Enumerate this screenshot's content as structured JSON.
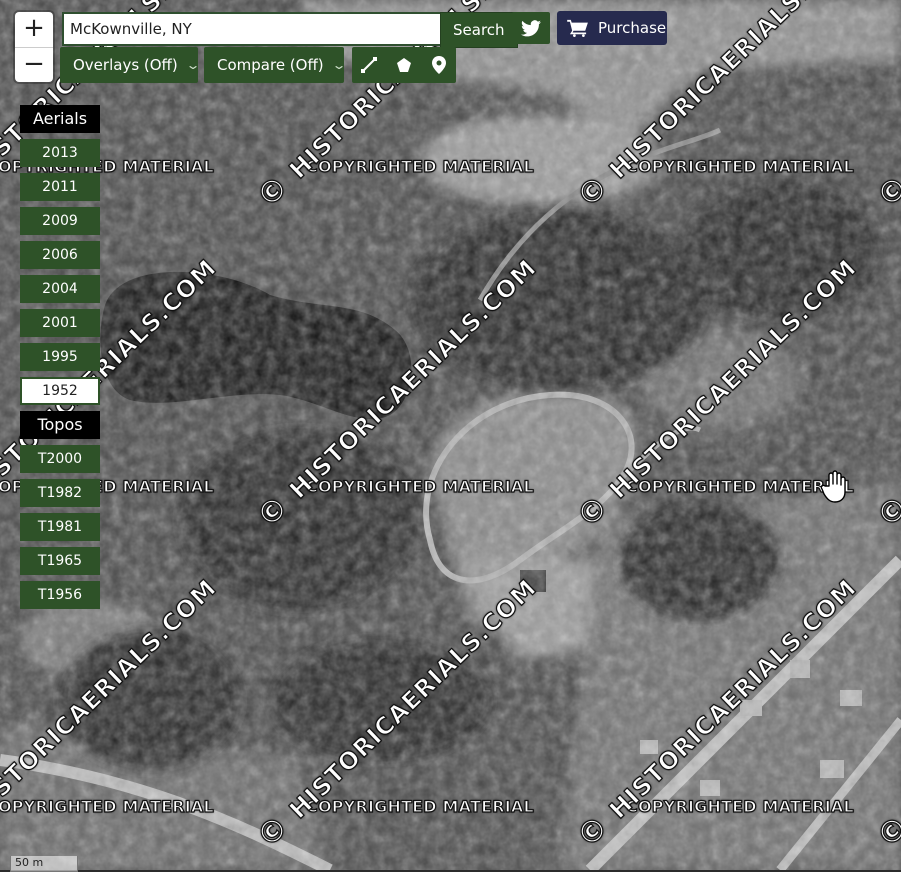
{
  "search": {
    "value": "McKownville, NY",
    "button_label": "Search"
  },
  "zoom": {
    "in_label": "+",
    "out_label": "−"
  },
  "toolbar": {
    "purchase_label": "Purchase",
    "overlays_label": "Overlays (Off)",
    "compare_label": "Compare (Off)",
    "twitter_icon": "twitter-icon",
    "cart_icon": "cart-icon",
    "tools": [
      "ruler-icon",
      "polygon-icon",
      "map-marker-icon"
    ]
  },
  "aerials": {
    "header": "Aerials",
    "years": [
      "2013",
      "2011",
      "2009",
      "2006",
      "2004",
      "2001",
      "1995",
      "1952"
    ],
    "selected": "1952"
  },
  "topos": {
    "header": "Topos",
    "years": [
      "T2000",
      "T1982",
      "T1981",
      "T1965",
      "T1956"
    ]
  },
  "watermark": {
    "copyright": "COPYRIGHTED MATERIAL",
    "diagonal_prefix": "©",
    "diagonal_text": "HISTORICAERIALS.COM"
  },
  "scale_label": "50 m",
  "colors": {
    "button_green": "#2e5228",
    "purchase_navy": "#262a4e"
  }
}
